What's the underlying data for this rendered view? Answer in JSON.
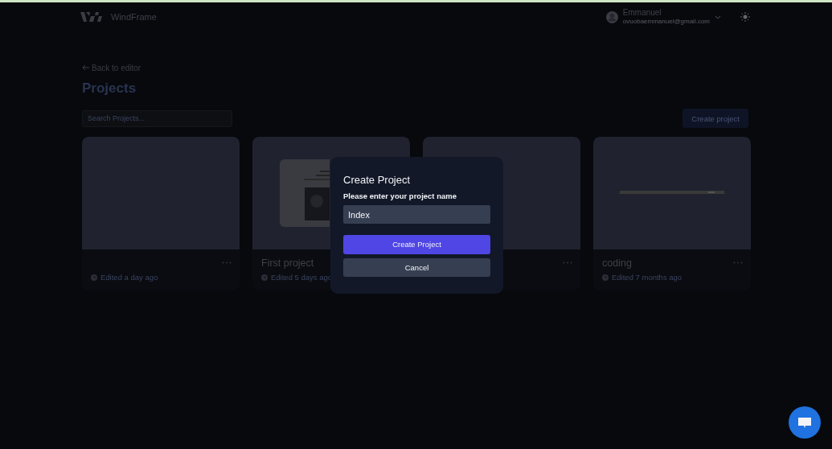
{
  "header": {
    "brand": "WindFrame",
    "user": {
      "name": "Emmanuel",
      "email": "ovuobaemmanuel@gmail.com"
    }
  },
  "back_link": "Back to editor",
  "title": "Projects",
  "search": {
    "placeholder": "Search Projects..."
  },
  "create_button": "Create project",
  "projects": [
    {
      "edited": "Edited a day ago",
      "kind": "blank"
    },
    {
      "name": "First project",
      "edited": "Edited 5 days ago",
      "kind": "page"
    },
    {
      "kind": "blank"
    },
    {
      "name": "coding",
      "edited": "Edited 7 months ago",
      "kind": "bar"
    }
  ],
  "dialog": {
    "title": "Create Project",
    "label": "Please enter your project name",
    "value": "Index",
    "primary": "Create Project",
    "secondary": "Cancel"
  }
}
